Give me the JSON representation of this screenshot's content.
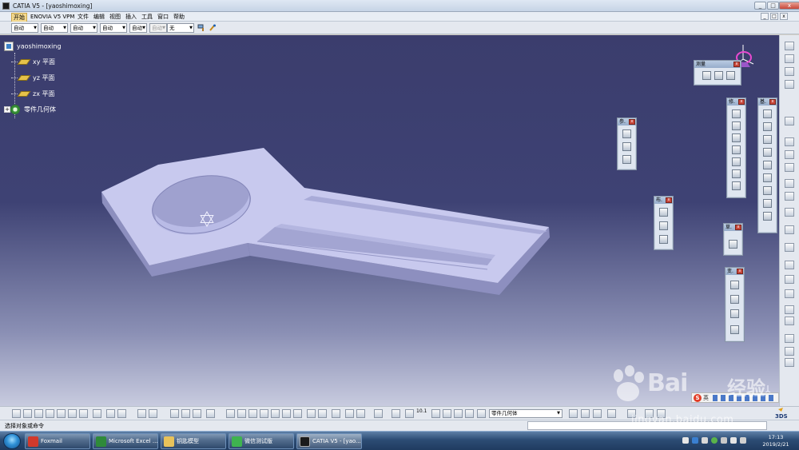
{
  "window": {
    "title": "CATIA V5 - [yaoshimoxing]",
    "controls": {
      "minimize": "_",
      "maximize": "□",
      "close": "x"
    }
  },
  "menu": {
    "items": [
      "开始",
      "ENOVIA V5 VPM",
      "文件",
      "编辑",
      "视图",
      "插入",
      "工具",
      "窗口",
      "帮助"
    ],
    "active_index": 0
  },
  "property_toolbar": {
    "dropdowns": [
      "自动",
      "自动",
      "自动",
      "自动",
      "自动",
      "自动",
      "无"
    ]
  },
  "tree": {
    "root": "yaoshimoxing",
    "items": [
      "xy 平面",
      "yz 平面",
      "zx 平面",
      "零件几何体"
    ]
  },
  "floating_toolbars": {
    "measure": "测量",
    "ref": "参.",
    "solid": "修.",
    "ops": "基.",
    "sketch": "草.",
    "feature": "布.",
    "transform": "变."
  },
  "bottom_toolbar": {
    "body_selector": "零件几何体",
    "zoom_label": "10.1"
  },
  "status": {
    "message": "选择对象或命令"
  },
  "ime": {
    "logo": "S",
    "lang": "英"
  },
  "watermark": {
    "brand": "Bai",
    "cn": "经验",
    "url": "jingyan.baidu.com"
  },
  "taskbar": {
    "items": [
      {
        "label": "Foxmail",
        "color": "#d23a2c"
      },
      {
        "label": "Microsoft Excel ...",
        "color": "#2f8a3a"
      },
      {
        "label": "钥匙模型",
        "color": "#e8c25a"
      },
      {
        "label": "微信测试版",
        "color": "#3fb34f"
      },
      {
        "label": "CATIA V5 - [yao...",
        "color": "#1b1b1b"
      }
    ],
    "active_index": 4,
    "time": "17:13",
    "date": "2019/2/21"
  },
  "colors": {
    "viewport_top": "#3b3d6d",
    "viewport_bottom": "#c8cbdf",
    "part_top": "#c8c9ee",
    "part_side": "#8d8fbf",
    "accent": "#f4d98e"
  }
}
